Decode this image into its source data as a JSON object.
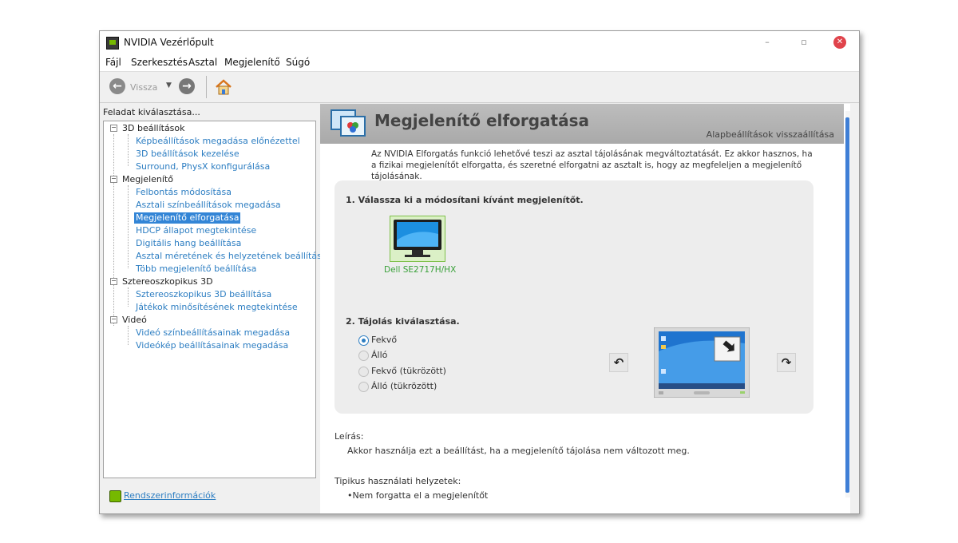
{
  "window": {
    "title": "NVIDIA Vezérlőpult",
    "controls": {
      "minimize": "–",
      "restore": "▫",
      "close": "✕"
    }
  },
  "menu": [
    "Fájl",
    "Szerkesztés",
    "Asztal",
    "Megjelenítő",
    "Súgó"
  ],
  "toolbar": {
    "back_label": "Vissza",
    "back_icon": "back-arrow-icon",
    "forward_icon": "forward-arrow-icon",
    "home_icon": "home-icon"
  },
  "sidebar": {
    "label": "Feladat kiválasztása...",
    "categories": [
      {
        "label": "3D beállítások",
        "items": [
          "Képbeállítások megadása előnézettel",
          "3D beállítások kezelése",
          "Surround, PhysX konfigurálása"
        ]
      },
      {
        "label": "Megjelenítő",
        "items": [
          "Felbontás módosítása",
          "Asztali színbeállítások megadása",
          "Megjelenítő elforgatása",
          "HDCP állapot megtekintése",
          "Digitális hang beállítása",
          "Asztal méretének és helyzetének beállítása",
          "Több megjelenítő beállítása"
        ]
      },
      {
        "label": "Sztereoszkopikus 3D",
        "items": [
          "Sztereoszkopikus 3D beállítása",
          "Játékok minősítésének megtekintése"
        ]
      },
      {
        "label": "Videó",
        "items": [
          "Videó színbeállításainak megadása",
          "Videókép beállításainak megadása"
        ]
      }
    ],
    "selected": "Megjelenítő elforgatása",
    "system_info": "Rendszerinformációk"
  },
  "content": {
    "title": "Megjelenítő elforgatása",
    "restore_defaults": "Alapbeállítások visszaállítása",
    "intro": "Az NVIDIA Elforgatás funkció lehetővé teszi az asztal tájolásának megváltoztatását. Ez akkor hasznos, ha a fizikai megjelenítőt elforgatta, és szeretné elforgatni az asztalt is, hogy az megfeleljen a megjelenítő tájolásának.",
    "step1": "1. Válassza ki a módosítani kívánt megjelenítőt.",
    "display_name": "Dell SE2717H/HX",
    "step2": "2. Tájolás kiválasztása.",
    "orientations": [
      "Fekvő",
      "Álló",
      "Fekvő (tükrözött)",
      "Álló (tükrözött)"
    ],
    "selected_orientation": "Fekvő",
    "rotate_left_icon": "↶",
    "rotate_right_icon": "↷",
    "description_label": "Leírás:",
    "description_text": "Akkor használja ezt a beállítást, ha a megjelenítő tájolása nem változott meg.",
    "usage_label": "Tipikus használati helyzetek:",
    "usage_items": [
      "Nem forgatta el a megjelenítőt"
    ]
  },
  "colors": {
    "accent": "#2d7ec2",
    "selection": "#3385d6",
    "nvidia_green": "#76b900",
    "close": "#e0434b",
    "scroll": "#3f7fd6"
  }
}
